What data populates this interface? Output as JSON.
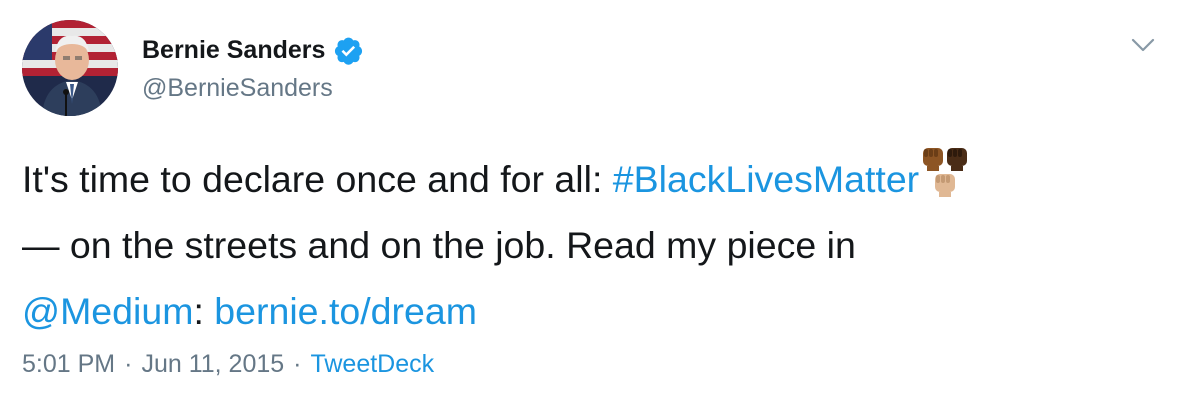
{
  "author": {
    "display_name": "Bernie Sanders",
    "handle": "@BernieSanders",
    "verified": true,
    "avatar_icon": "profile-photo"
  },
  "tweet": {
    "line1_text": "It's time to declare once and for all: ",
    "hashtag": "#BlackLivesMatter",
    "emoji": "raised-fists-multiple-skin-tones",
    "line2_text": "— on the streets and on the job. Read my piece in",
    "mention": "@Medium",
    "colon": ": ",
    "url": "bernie.to/dream"
  },
  "meta": {
    "time": "5:01 PM",
    "separator": "·",
    "date": "Jun 11, 2015",
    "source": "TweetDeck"
  },
  "colors": {
    "link": "#1b95e0",
    "secondary_text": "#657786",
    "verified_badge": "#1da1f2"
  }
}
